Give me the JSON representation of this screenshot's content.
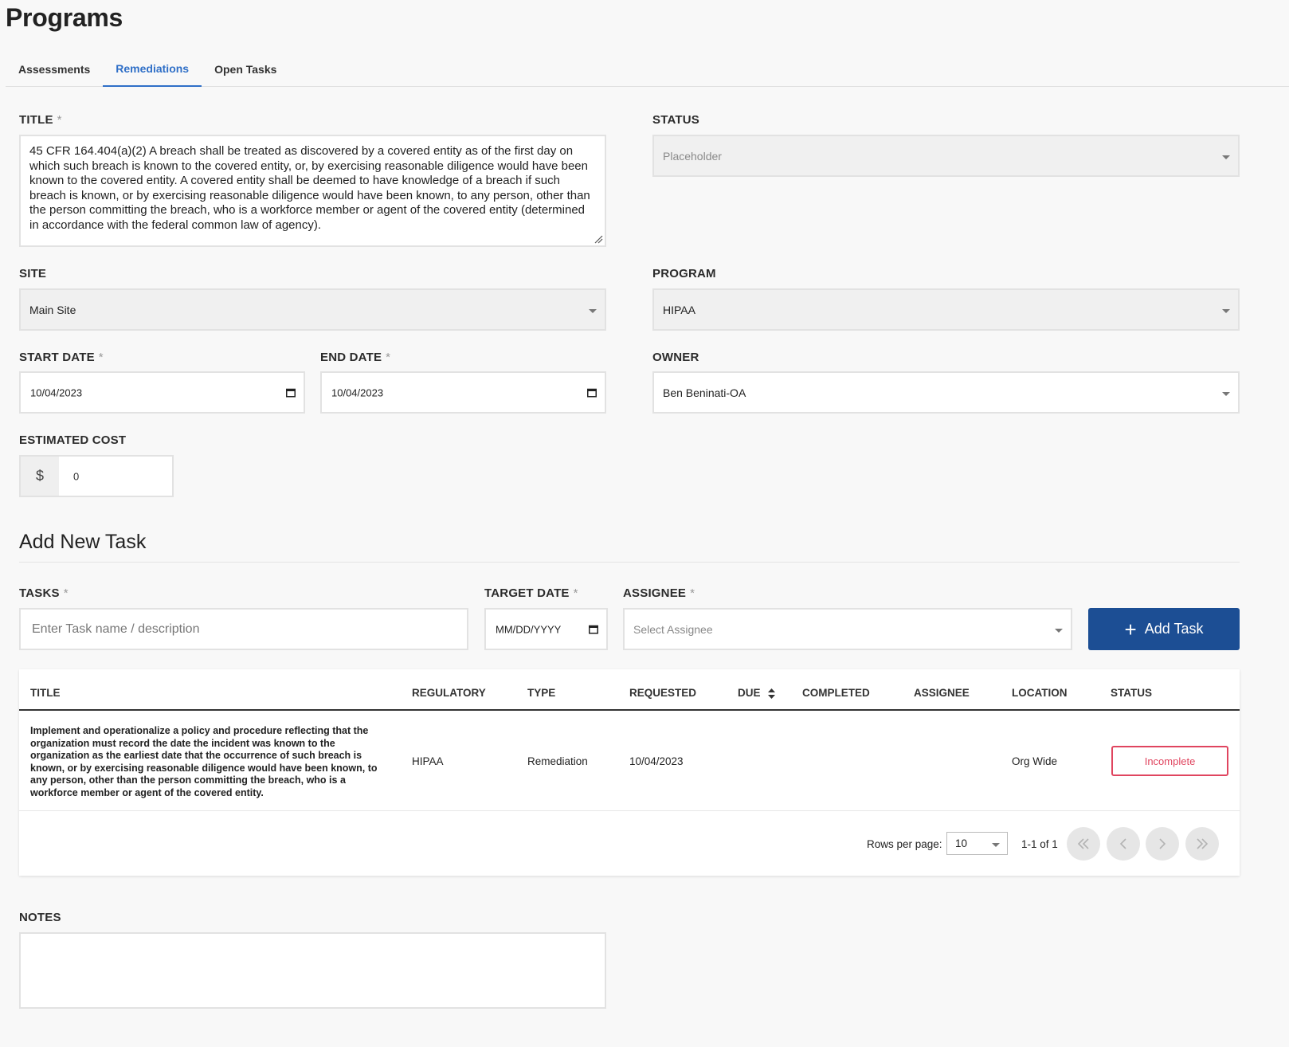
{
  "page": {
    "title": "Programs"
  },
  "tabs": [
    {
      "label": "Assessments",
      "active": false
    },
    {
      "label": "Remediations",
      "active": true
    },
    {
      "label": "Open Tasks",
      "active": false
    }
  ],
  "form": {
    "title": {
      "label": "TITLE",
      "required": "*",
      "value": "45 CFR 164.404(a)(2) A breach shall be treated as discovered by a covered entity as of the first day on which such breach is known to the covered entity, or, by exercising reasonable diligence would have been known to the covered entity. A covered entity shall be deemed to have knowledge of a breach if such breach is known, or by exercising reasonable diligence would have been known, to any person, other than the person committing the breach, who is a workforce member or agent of the covered entity (determined in accordance with the federal common law of agency)."
    },
    "status": {
      "label": "STATUS",
      "placeholder": "Placeholder"
    },
    "site": {
      "label": "SITE",
      "value": "Main Site"
    },
    "program": {
      "label": "PROGRAM",
      "value": "HIPAA"
    },
    "start_date": {
      "label": "START DATE",
      "required": "*",
      "value": "10/04/2023"
    },
    "end_date": {
      "label": "END DATE",
      "required": "*",
      "value": "10/04/2023"
    },
    "owner": {
      "label": "OWNER",
      "value": "Ben Beninati-OA"
    },
    "estimated_cost": {
      "label": "ESTIMATED COST",
      "currency": "$",
      "value": "0"
    }
  },
  "add_task": {
    "heading": "Add New Task",
    "tasks": {
      "label": "TASKS",
      "required": "*",
      "placeholder": "Enter Task name / description"
    },
    "target_date": {
      "label": "TARGET DATE",
      "required": "*",
      "placeholder": "MM/DD/YYYY"
    },
    "assignee": {
      "label": "ASSIGNEE",
      "required": "*",
      "placeholder": "Select Assignee"
    },
    "button": {
      "icon": "plus-icon",
      "label": "Add Task"
    }
  },
  "table": {
    "headers": {
      "title": "TITLE",
      "regulatory": "REGULATORY",
      "type": "TYPE",
      "requested": "REQUESTED",
      "due": "DUE",
      "completed": "COMPLETED",
      "assignee": "ASSIGNEE",
      "location": "LOCATION",
      "status": "STATUS"
    },
    "rows": [
      {
        "title": "Implement and operationalize a policy and procedure reflecting that the organization must record the date the incident was known to the organization as the earliest date that the occurrence of such breach is known, or by exercising reasonable diligence would have been known, to any person, other than the person committing the breach, who is a workforce member or agent of the covered entity.",
        "regulatory": "HIPAA",
        "type": "Remediation",
        "requested": "10/04/2023",
        "due": "",
        "completed": "",
        "assignee": "",
        "location": "Org Wide",
        "status": "Incomplete"
      }
    ],
    "pagination": {
      "rows_per_page_label": "Rows per page:",
      "rows_per_page": "10",
      "range": "1-1 of 1"
    }
  },
  "notes": {
    "label": "NOTES",
    "value": ""
  },
  "colors": {
    "accent": "#2f6fc7",
    "button": "#1c4e94",
    "status_incomplete": "#e0455f"
  }
}
